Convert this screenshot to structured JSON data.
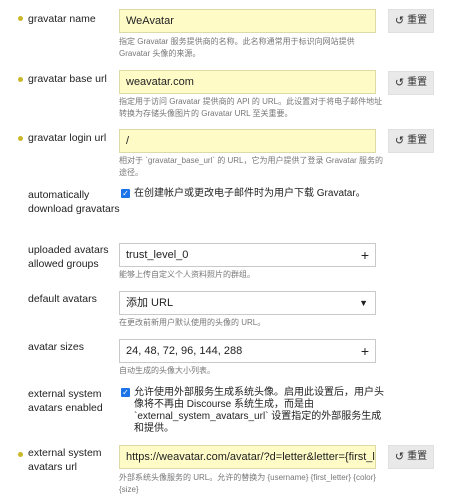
{
  "settings": {
    "gravatar_name": {
      "label": "gravatar name",
      "value": "WeAvatar",
      "help": "指定 Gravatar 服务提供商的名称。此名称通常用于标识向网站提供 Gravatar 头像的来源。",
      "reset": "重置"
    },
    "gravatar_base_url": {
      "label": "gravatar base url",
      "value": "weavatar.com",
      "help": "指定用于访问 Gravatar 提供商的 API 的 URL。此设置对于将电子邮件地址转换为存储头像图片的 Gravatar URL 至关重要。",
      "reset": "重置"
    },
    "gravatar_login_url": {
      "label": "gravatar login url",
      "value": "/",
      "help": "相对于 `gravatar_base_url` 的 URL，它为用户提供了登录 Gravatar 服务的途径。",
      "reset": "重置"
    },
    "automatically_download_gravatars": {
      "label": "automatically download gravatars",
      "checkbox_text": "在创建帐户或更改电子邮件时为用户下载 Gravatar。"
    },
    "uploaded_avatars_allowed_groups": {
      "label": "uploaded avatars allowed groups",
      "value": "trust_level_0",
      "help": "能够上传自定义个人资料照片的群组。"
    },
    "default_avatars": {
      "label": "default avatars",
      "value": "添加 URL",
      "help": "在更改前新用户默认使用的头像的 URL。"
    },
    "avatar_sizes": {
      "label": "avatar sizes",
      "value": "24, 48, 72, 96, 144, 288",
      "help": "自动生成的头像大小列表。"
    },
    "external_system_avatars_enabled": {
      "label": "external system avatars enabled",
      "checkbox_text": "允许使用外部服务生成系统头像。启用此设置后，用户头像将不再由 Discourse 系统生成，而是由 `external_system_avatars_url` 设置指定的外部服务生成和提供。"
    },
    "external_system_avatars_url": {
      "label": "external system avatars url",
      "value": "https://weavatar.com/avatar/?d=letter&letter={first_letter",
      "help": "外部系统头像服务的 URL。允许的替换为 {username} {first_letter} {color} {size}",
      "reset": "重置"
    }
  },
  "icons": {
    "reset": "undo-icon",
    "dropdown": "caret-down-icon",
    "add": "plus-icon",
    "checkbox": "checkmark-icon"
  },
  "colors": {
    "changed_field_bg": "#fefbc7",
    "changed_indicator": "#c9b82a",
    "checkbox": "#1a73e8"
  }
}
